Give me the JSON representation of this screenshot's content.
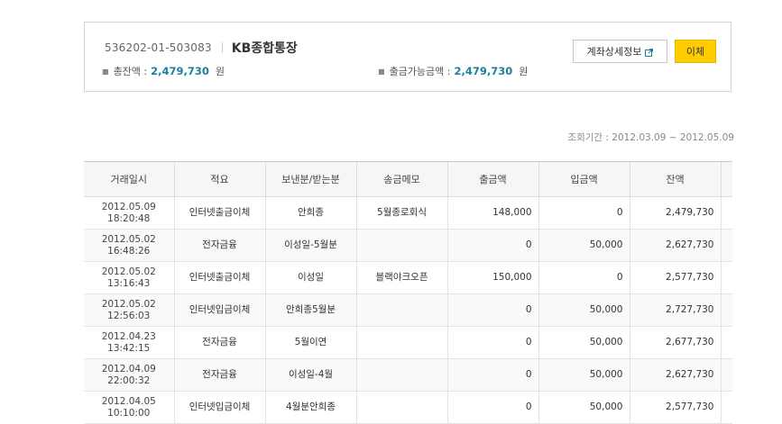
{
  "account": {
    "number": "536202-01-503083",
    "name": "KB종합통장",
    "total_label": "총잔액 :",
    "total_amount": "2,479,730",
    "total_unit": "원",
    "available_label": "출금가능금액 :",
    "available_amount": "2,479,730",
    "available_unit": "원"
  },
  "buttons": {
    "detail_label": "계좌상세정보",
    "transfer_label": "이체"
  },
  "period": {
    "label": "조회기간 :",
    "value": "2012.03.09 ~ 2012.05.09"
  },
  "table": {
    "headers": [
      "거래일시",
      "적요",
      "보낸분/받는분",
      "송금메모",
      "출금액",
      "입금액",
      "잔액"
    ],
    "rows": [
      {
        "date": "2012.05.09",
        "time": "18:20:48",
        "desc": "인터넷출금이체",
        "party": "안희종",
        "memo": "5월종로회식",
        "out": "148,000",
        "in": "0",
        "balance": "2,479,730"
      },
      {
        "date": "2012.05.02",
        "time": "16:48:26",
        "desc": "전자금융",
        "party": "이성일-5월분",
        "memo": "",
        "out": "0",
        "in": "50,000",
        "balance": "2,627,730"
      },
      {
        "date": "2012.05.02",
        "time": "13:16:43",
        "desc": "인터넷출금이체",
        "party": "이성일",
        "memo": "블랙야크오픈",
        "out": "150,000",
        "in": "0",
        "balance": "2,577,730"
      },
      {
        "date": "2012.05.02",
        "time": "12:56:03",
        "desc": "인터넷입금이체",
        "party": "안희종5월분",
        "memo": "",
        "out": "0",
        "in": "50,000",
        "balance": "2,727,730"
      },
      {
        "date": "2012.04.23",
        "time": "13:42:15",
        "desc": "전자금융",
        "party": "5월이연",
        "memo": "",
        "out": "0",
        "in": "50,000",
        "balance": "2,677,730"
      },
      {
        "date": "2012.04.09",
        "time": "22:00:32",
        "desc": "전자금융",
        "party": "이성일-4월",
        "memo": "",
        "out": "0",
        "in": "50,000",
        "balance": "2,627,730"
      },
      {
        "date": "2012.04.05",
        "time": "10:10:00",
        "desc": "인터넷입금이체",
        "party": "4월분안희종",
        "memo": "",
        "out": "0",
        "in": "50,000",
        "balance": "2,577,730"
      }
    ]
  }
}
